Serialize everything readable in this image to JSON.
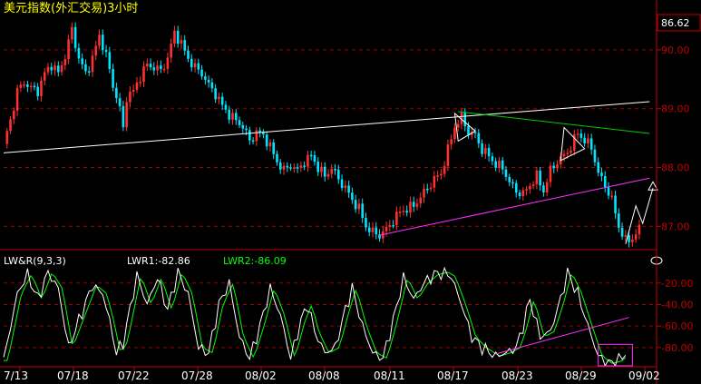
{
  "chart_data": [
    {
      "type": "candlestick",
      "title": "美元指数(外汇交易)3小时",
      "last_price_label": "86.62",
      "y_ticks": [
        "90.00",
        "89.00",
        "88.00",
        "87.00"
      ],
      "y_tick_values": [
        90,
        89,
        88,
        87
      ],
      "ylim": [
        86.62,
        90.6
      ],
      "grid": true,
      "grid_style": "dashed",
      "candle_colors": {
        "up": "#ff3030",
        "down": "#00e5ff"
      },
      "x_tick_labels": [
        "7/13",
        "07/18",
        "07/22",
        "07/28",
        "08/02",
        "08/08",
        "08/11",
        "08/17",
        "08/23",
        "08/29",
        "09/02"
      ],
      "close_path": [
        [
          0,
          88.4
        ],
        [
          2,
          88.8
        ],
        [
          4,
          89.3
        ],
        [
          6,
          89.45
        ],
        [
          8,
          89.35
        ],
        [
          10,
          89.3
        ],
        [
          12,
          89.6
        ],
        [
          14,
          89.75
        ],
        [
          16,
          89.6
        ],
        [
          18,
          89.9
        ],
        [
          20,
          90.35
        ],
        [
          22,
          89.85
        ],
        [
          24,
          89.6
        ],
        [
          26,
          89.85
        ],
        [
          28,
          90.25
        ],
        [
          30,
          89.9
        ],
        [
          32,
          89.4
        ],
        [
          34,
          89.0
        ],
        [
          35,
          88.65
        ],
        [
          36,
          89.2
        ],
        [
          38,
          89.3
        ],
        [
          40,
          89.55
        ],
        [
          42,
          89.75
        ],
        [
          44,
          89.7
        ],
        [
          46,
          89.65
        ],
        [
          48,
          89.85
        ],
        [
          50,
          90.3
        ],
        [
          52,
          90.1
        ],
        [
          54,
          89.85
        ],
        [
          56,
          89.7
        ],
        [
          58,
          89.6
        ],
        [
          60,
          89.4
        ],
        [
          62,
          89.25
        ],
        [
          64,
          89.05
        ],
        [
          66,
          88.9
        ],
        [
          68,
          88.8
        ],
        [
          70,
          88.7
        ],
        [
          72,
          88.45
        ],
        [
          74,
          88.6
        ],
        [
          76,
          88.55
        ],
        [
          78,
          88.35
        ],
        [
          80,
          88.1
        ],
        [
          82,
          87.95
        ],
        [
          84,
          88.05
        ],
        [
          86,
          87.95
        ],
        [
          88,
          88.1
        ],
        [
          90,
          88.2
        ],
        [
          92,
          88.0
        ],
        [
          94,
          87.85
        ],
        [
          96,
          88.0
        ],
        [
          98,
          87.8
        ],
        [
          100,
          87.65
        ],
        [
          102,
          87.45
        ],
        [
          104,
          87.3
        ],
        [
          106,
          87.0
        ],
        [
          108,
          86.9
        ],
        [
          110,
          86.85
        ],
        [
          112,
          86.95
        ],
        [
          114,
          87.1
        ],
        [
          116,
          87.25
        ],
        [
          118,
          87.3
        ],
        [
          120,
          87.35
        ],
        [
          122,
          87.5
        ],
        [
          124,
          87.65
        ],
        [
          126,
          87.8
        ],
        [
          128,
          87.9
        ],
        [
          130,
          88.3
        ],
        [
          132,
          88.7
        ],
        [
          134,
          88.85
        ],
        [
          136,
          88.6
        ],
        [
          138,
          88.55
        ],
        [
          140,
          88.3
        ],
        [
          142,
          88.2
        ],
        [
          144,
          88.05
        ],
        [
          146,
          88.0
        ],
        [
          148,
          87.75
        ],
        [
          150,
          87.6
        ],
        [
          152,
          87.55
        ],
        [
          154,
          87.7
        ],
        [
          156,
          87.85
        ],
        [
          158,
          87.6
        ],
        [
          160,
          87.95
        ],
        [
          162,
          88.1
        ],
        [
          164,
          88.2
        ],
        [
          166,
          88.35
        ],
        [
          168,
          88.6
        ],
        [
          170,
          88.45
        ],
        [
          172,
          88.35
        ],
        [
          174,
          87.9
        ],
        [
          176,
          87.7
        ],
        [
          178,
          87.45
        ],
        [
          180,
          87.0
        ],
        [
          182,
          86.75
        ],
        [
          184,
          86.8
        ],
        [
          186,
          86.95
        ]
      ],
      "n_slots": 190,
      "trendlines": [
        {
          "color": "#ffffff",
          "from": [
            0,
            88.25
          ],
          "to": [
            189,
            89.12
          ]
        },
        {
          "color": "#00cc00",
          "from": [
            133,
            88.95
          ],
          "to": [
            189,
            88.58
          ]
        },
        {
          "color": "#ff30ff",
          "from": [
            110,
            86.85
          ],
          "to": [
            189,
            87.82
          ]
        }
      ],
      "triangles": [
        {
          "color": "#ffffff",
          "points": [
            [
              132,
              88.92
            ],
            [
              138,
              88.62
            ],
            [
              133,
              88.45
            ]
          ]
        },
        {
          "color": "#ffffff",
          "points": [
            [
              164,
              88.68
            ],
            [
              170,
              88.32
            ],
            [
              163,
              88.12
            ]
          ]
        }
      ],
      "arrow": {
        "color": "#ffffff",
        "points": [
          [
            182,
            86.7
          ],
          [
            185,
            87.35
          ],
          [
            187,
            87.05
          ],
          [
            190,
            87.65
          ]
        ]
      }
    },
    {
      "type": "line",
      "title": "LW&R(9,3,3)",
      "series": [
        {
          "name": "LWR1",
          "value_label": "LWR1:-82.86",
          "color": "#ffffff"
        },
        {
          "name": "LWR2",
          "value_label": "LWR2:-86.09",
          "color": "#00ff00"
        }
      ],
      "y_ticks": [
        "-20.00",
        "-40.00",
        "-60.00",
        "-80.00"
      ],
      "y_tick_values": [
        -20,
        -40,
        -60,
        -80
      ],
      "ylim": [
        -97,
        -5
      ],
      "grid": true,
      "x_tick_labels": [
        "7/13",
        "07/18",
        "07/22",
        "07/28",
        "08/02",
        "08/08",
        "08/11",
        "08/17",
        "08/23",
        "08/29",
        "09/02"
      ],
      "anchors": [
        [
          0,
          -92
        ],
        [
          4,
          -30
        ],
        [
          7,
          -12
        ],
        [
          10,
          -35
        ],
        [
          13,
          -10
        ],
        [
          16,
          -25
        ],
        [
          19,
          -80
        ],
        [
          22,
          -55
        ],
        [
          26,
          -22
        ],
        [
          29,
          -30
        ],
        [
          31,
          -55
        ],
        [
          33,
          -85
        ],
        [
          35,
          -75
        ],
        [
          39,
          -13
        ],
        [
          42,
          -40
        ],
        [
          45,
          -15
        ],
        [
          48,
          -45
        ],
        [
          51,
          -10
        ],
        [
          54,
          -30
        ],
        [
          57,
          -80
        ],
        [
          60,
          -85
        ],
        [
          63,
          -40
        ],
        [
          66,
          -20
        ],
        [
          69,
          -70
        ],
        [
          72,
          -90
        ],
        [
          75,
          -60
        ],
        [
          78,
          -25
        ],
        [
          81,
          -50
        ],
        [
          84,
          -90
        ],
        [
          87,
          -55
        ],
        [
          89,
          -40
        ],
        [
          91,
          -65
        ],
        [
          94,
          -85
        ],
        [
          97,
          -80
        ],
        [
          100,
          -45
        ],
        [
          102,
          -25
        ],
        [
          105,
          -60
        ],
        [
          108,
          -85
        ],
        [
          111,
          -90
        ],
        [
          114,
          -55
        ],
        [
          117,
          -15
        ],
        [
          120,
          -35
        ],
        [
          123,
          -20
        ],
        [
          126,
          -12
        ],
        [
          129,
          -10
        ],
        [
          131,
          -14
        ],
        [
          134,
          -40
        ],
        [
          137,
          -70
        ],
        [
          140,
          -80
        ],
        [
          144,
          -88
        ],
        [
          147,
          -85
        ],
        [
          150,
          -80
        ],
        [
          152,
          -60
        ],
        [
          154,
          -35
        ],
        [
          157,
          -70
        ],
        [
          160,
          -65
        ],
        [
          163,
          -35
        ],
        [
          165,
          -10
        ],
        [
          168,
          -30
        ],
        [
          171,
          -60
        ],
        [
          174,
          -88
        ],
        [
          177,
          -95
        ],
        [
          180,
          -92
        ],
        [
          182,
          -85
        ]
      ],
      "support_line": {
        "color": "#ff30ff",
        "from": [
          144,
          -86
        ],
        "to": [
          183,
          -52
        ]
      },
      "highlight_box": {
        "color": "#ff30ff",
        "from": [
          174,
          -77
        ],
        "to": [
          184,
          -97
        ]
      }
    }
  ]
}
